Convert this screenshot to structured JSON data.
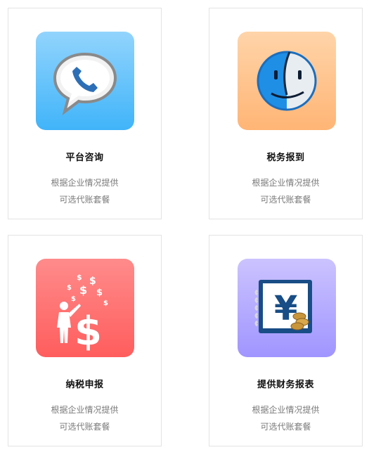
{
  "cards": [
    {
      "title": "平台咨询",
      "desc_line1": "根据企业情况提供",
      "desc_line2": "可选代账套餐",
      "icon": "phone-chat-bubble-icon",
      "tile_color": "#5bbffa"
    },
    {
      "title": "税务报到",
      "desc_line1": "根据企业情况提供",
      "desc_line2": "可选代账套餐",
      "icon": "finder-face-icon",
      "tile_color": "#ffc48e"
    },
    {
      "title": "纳税申报",
      "desc_line1": "根据企业情况提供",
      "desc_line2": "可选代账套餐",
      "icon": "money-presenter-icon",
      "tile_color": "#ff7070"
    },
    {
      "title": "提供财务报表",
      "desc_line1": "根据企业情况提供",
      "desc_line2": "可选代账套餐",
      "icon": "yen-ledger-icon",
      "tile_color": "#b4abff"
    }
  ]
}
